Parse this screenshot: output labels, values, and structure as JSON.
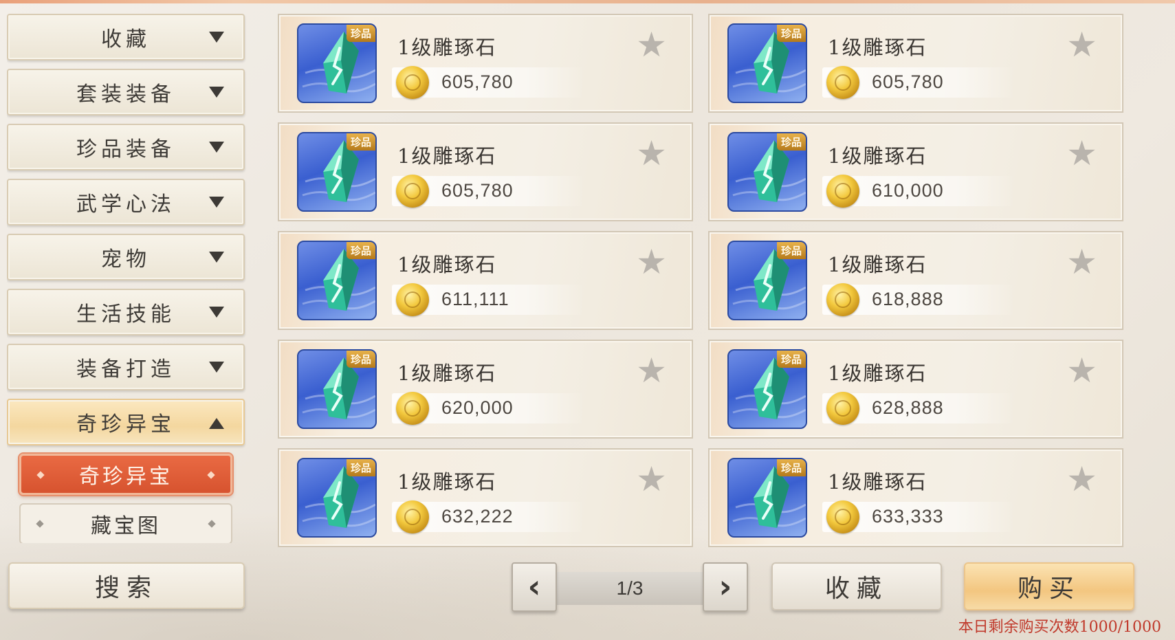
{
  "sidebar": {
    "categories": [
      {
        "label": "收藏"
      },
      {
        "label": "套装装备"
      },
      {
        "label": "珍品装备"
      },
      {
        "label": "武学心法"
      },
      {
        "label": "宠物"
      },
      {
        "label": "生活技能"
      },
      {
        "label": "装备打造"
      },
      {
        "label": "奇珍异宝"
      }
    ],
    "subitems": [
      {
        "label": "奇珍异宝",
        "active": true
      },
      {
        "label": "藏宝图",
        "active": false
      }
    ]
  },
  "search": {
    "label": "搜索"
  },
  "listings": [
    {
      "tag": "珍品",
      "name": "1级雕琢石",
      "price": "605,780",
      "icon": "jade-crystal-icon"
    },
    {
      "tag": "珍品",
      "name": "1级雕琢石",
      "price": "605,780",
      "icon": "jade-crystal-icon"
    },
    {
      "tag": "珍品",
      "name": "1级雕琢石",
      "price": "605,780",
      "icon": "jade-crystal-icon"
    },
    {
      "tag": "珍品",
      "name": "1级雕琢石",
      "price": "610,000",
      "icon": "jade-crystal-icon"
    },
    {
      "tag": "珍品",
      "name": "1级雕琢石",
      "price": "611,111",
      "icon": "jade-crystal-icon"
    },
    {
      "tag": "珍品",
      "name": "1级雕琢石",
      "price": "618,888",
      "icon": "jade-crystal-icon"
    },
    {
      "tag": "珍品",
      "name": "1级雕琢石",
      "price": "620,000",
      "icon": "jade-crystal-icon"
    },
    {
      "tag": "珍品",
      "name": "1级雕琢石",
      "price": "628,888",
      "icon": "jade-crystal-icon"
    },
    {
      "tag": "珍品",
      "name": "1级雕琢石",
      "price": "632,222",
      "icon": "jade-crystal-icon"
    },
    {
      "tag": "珍品",
      "name": "1级雕琢石",
      "price": "633,333",
      "icon": "jade-crystal-icon"
    }
  ],
  "pager": {
    "page": "1/3",
    "prev_icon": "‹",
    "next_icon": "›"
  },
  "actions": {
    "favorite_label": "收藏",
    "buy_label": "购买"
  },
  "status": {
    "remaining_purchases": "本日剩余购买次数1000/1000"
  },
  "colors": {
    "accent": "#d7532f",
    "buy": "#f3c680",
    "remaining_text": "#c0392b"
  }
}
